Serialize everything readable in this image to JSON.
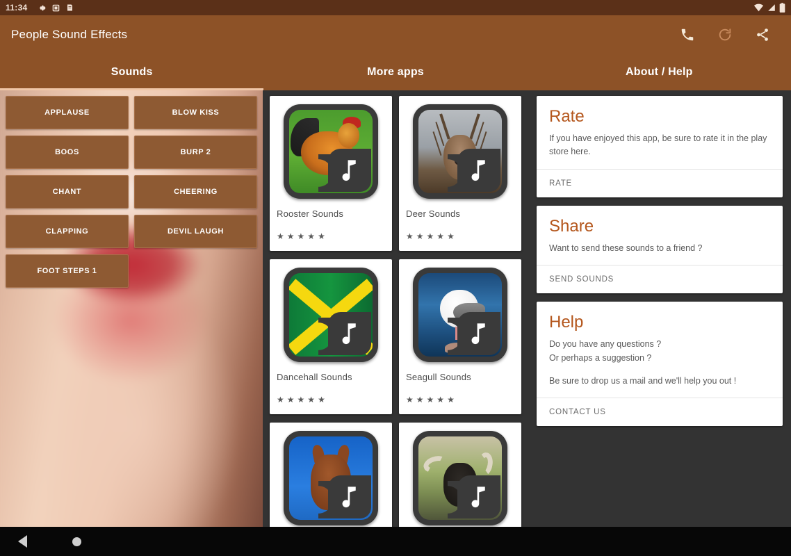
{
  "status_bar": {
    "time": "11:34",
    "left_icons": [
      "gear-icon",
      "app-icon-1",
      "app-icon-2"
    ],
    "right_icons": [
      "wifi-icon",
      "signal-icon",
      "battery-icon"
    ],
    "background_color": "#5b3018"
  },
  "app_bar": {
    "title": "People Sound Effects",
    "background_color": "#8d5227",
    "actions": [
      "phone-icon",
      "refresh-icon",
      "share-icon"
    ]
  },
  "tabs": {
    "active_index": 0,
    "indicator_color": "#f0c7a8",
    "items": [
      {
        "label": "Sounds"
      },
      {
        "label": "More apps"
      },
      {
        "label": "About / Help"
      }
    ]
  },
  "sounds_pane": {
    "button_color": "#8e5a33",
    "buttons": [
      {
        "label": "APPLAUSE"
      },
      {
        "label": "BLOW KISS"
      },
      {
        "label": "BOOS"
      },
      {
        "label": "BURP 2"
      },
      {
        "label": "CHANT"
      },
      {
        "label": "CHEERING"
      },
      {
        "label": "CLAPPING"
      },
      {
        "label": "DEVIL LAUGH"
      },
      {
        "label": "FOOT STEPS 1"
      }
    ]
  },
  "more_apps_pane": {
    "background_color": "#333333",
    "rating_stars": 5,
    "star_glyph": "★",
    "apps": [
      {
        "name": "Rooster Sounds",
        "art": "art-rooster",
        "badge": "music-note-icon"
      },
      {
        "name": "Deer Sounds",
        "art": "art-deer",
        "badge": "music-note-icon"
      },
      {
        "name": "Dancehall Sounds",
        "art": "art-dancehall",
        "badge": "music-note-icon"
      },
      {
        "name": "Seagull Sounds",
        "art": "art-seagull",
        "badge": "music-note-icon"
      },
      {
        "name": "",
        "art": "art-horse",
        "badge": "music-note-icon"
      },
      {
        "name": "",
        "art": "art-buffalo",
        "badge": "music-note-icon"
      }
    ]
  },
  "about_pane": {
    "accent_color": "#b4561c",
    "cards": [
      {
        "title": "Rate",
        "lines": [
          "If you have enjoyed this app, be sure to rate it in the play store here."
        ],
        "action": "RATE"
      },
      {
        "title": "Share",
        "lines": [
          "Want to send these sounds to a friend ?"
        ],
        "action": "SEND SOUNDS"
      },
      {
        "title": "Help",
        "lines": [
          "Do you have any questions ?",
          "Or perhaps a suggestion ?",
          "Be sure to drop us a mail and we'll help you out !"
        ],
        "action": "CONTACT US"
      }
    ]
  },
  "nav_bar": {
    "back": "back-triangle-icon",
    "home": "home-circle-icon"
  }
}
